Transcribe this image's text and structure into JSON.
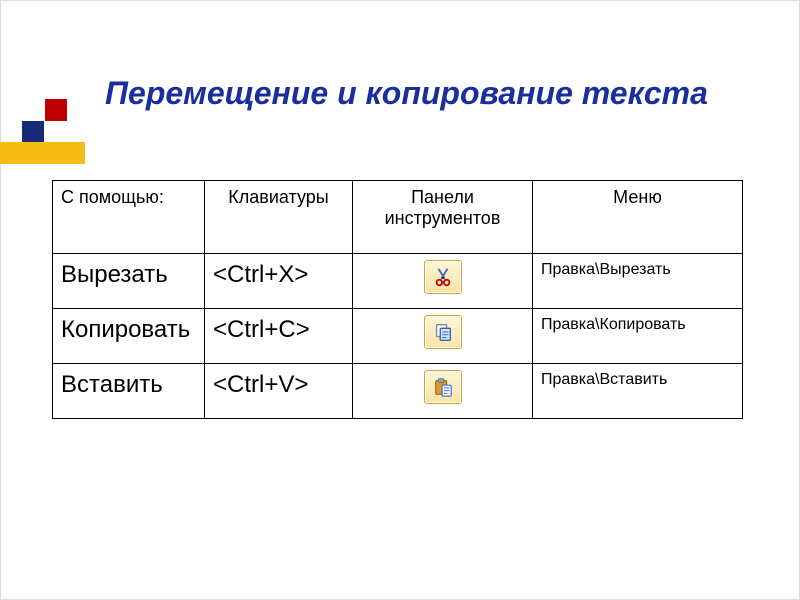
{
  "title": "Перемещение и копирование текста",
  "table": {
    "headers": {
      "with": "С помощью:",
      "keyboard": "Клавиатуры",
      "toolbar": "Панели инструментов",
      "menu": "Меню"
    },
    "rows": [
      {
        "action": "Вырезать",
        "shortcut": "<Ctrl+X>",
        "icon": "cut-icon",
        "menu": "Правка\\Вырезать"
      },
      {
        "action": "Копировать",
        "shortcut": "<Ctrl+C>",
        "icon": "copy-icon",
        "menu": "Правка\\Копировать"
      },
      {
        "action": "Вставить",
        "shortcut": "<Ctrl+V>",
        "icon": "paste-icon",
        "menu": "Правка\\Вставить"
      }
    ]
  }
}
